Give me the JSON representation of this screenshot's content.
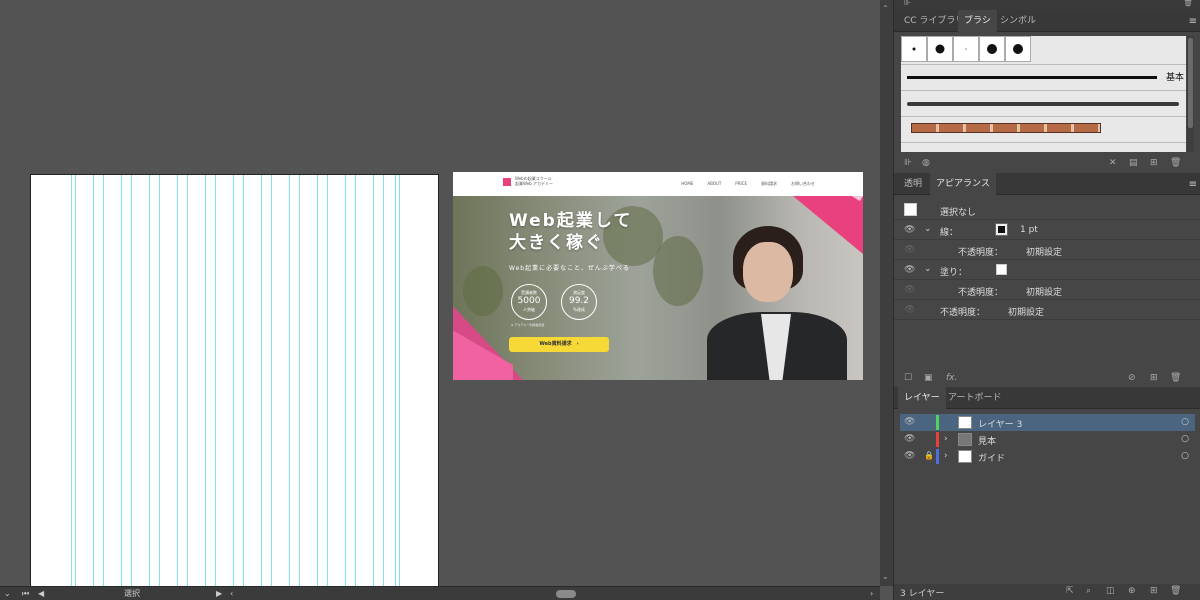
{
  "canvas": {
    "mockup": {
      "logo_line1": "Webの起業スクール",
      "logo_line2": "起業Web アカデミー",
      "nav": [
        "HOME",
        "ABOUT",
        "PRICE",
        "資料請求",
        "お問い合わせ"
      ],
      "hero_title_line1": "Web起業して",
      "hero_title_line2": "大きく稼ぐ",
      "hero_subtitle": "Web起業に必要なこと、ぜんぶ学べる",
      "badges": [
        {
          "label": "受講者数",
          "value": "5000",
          "suffix": "人突破"
        },
        {
          "label": "満足度",
          "value": "99.2",
          "suffix": "%達成"
        }
      ],
      "note": "※ アカデミー利用者調査",
      "cta": "Web資料請求　›"
    }
  },
  "statusbar": {
    "tool_label": "選択"
  },
  "brush_panel": {
    "tabs": [
      "CC ライブラリ",
      "ブラシ",
      "シンボル"
    ],
    "active_tab": 1,
    "basic_label": "基本"
  },
  "appearance_panel": {
    "tabs": [
      "透明",
      "アピアランス"
    ],
    "active_tab": 1,
    "no_selection": "選択なし",
    "stroke_label": "線：",
    "stroke_value": "1 pt",
    "opacity_label": "不透明度：",
    "opacity_value": "初期設定",
    "fill_label": "塗り：",
    "fill_opacity_label": "不透明度：",
    "fill_opacity_value": "初期設定",
    "root_opacity_label": "不透明度：",
    "root_opacity_value": "初期設定"
  },
  "layers_panel": {
    "tabs": [
      "レイヤー",
      "アートボード"
    ],
    "active_tab": 0,
    "layers": [
      {
        "name": "レイヤー 3",
        "color": "#4fd35c",
        "selected": true
      },
      {
        "name": "見本",
        "color": "#e8413c",
        "selected": false
      },
      {
        "name": "ガイド",
        "color": "#4f6fe0",
        "selected": false
      }
    ],
    "count_label": "3 レイヤー"
  }
}
